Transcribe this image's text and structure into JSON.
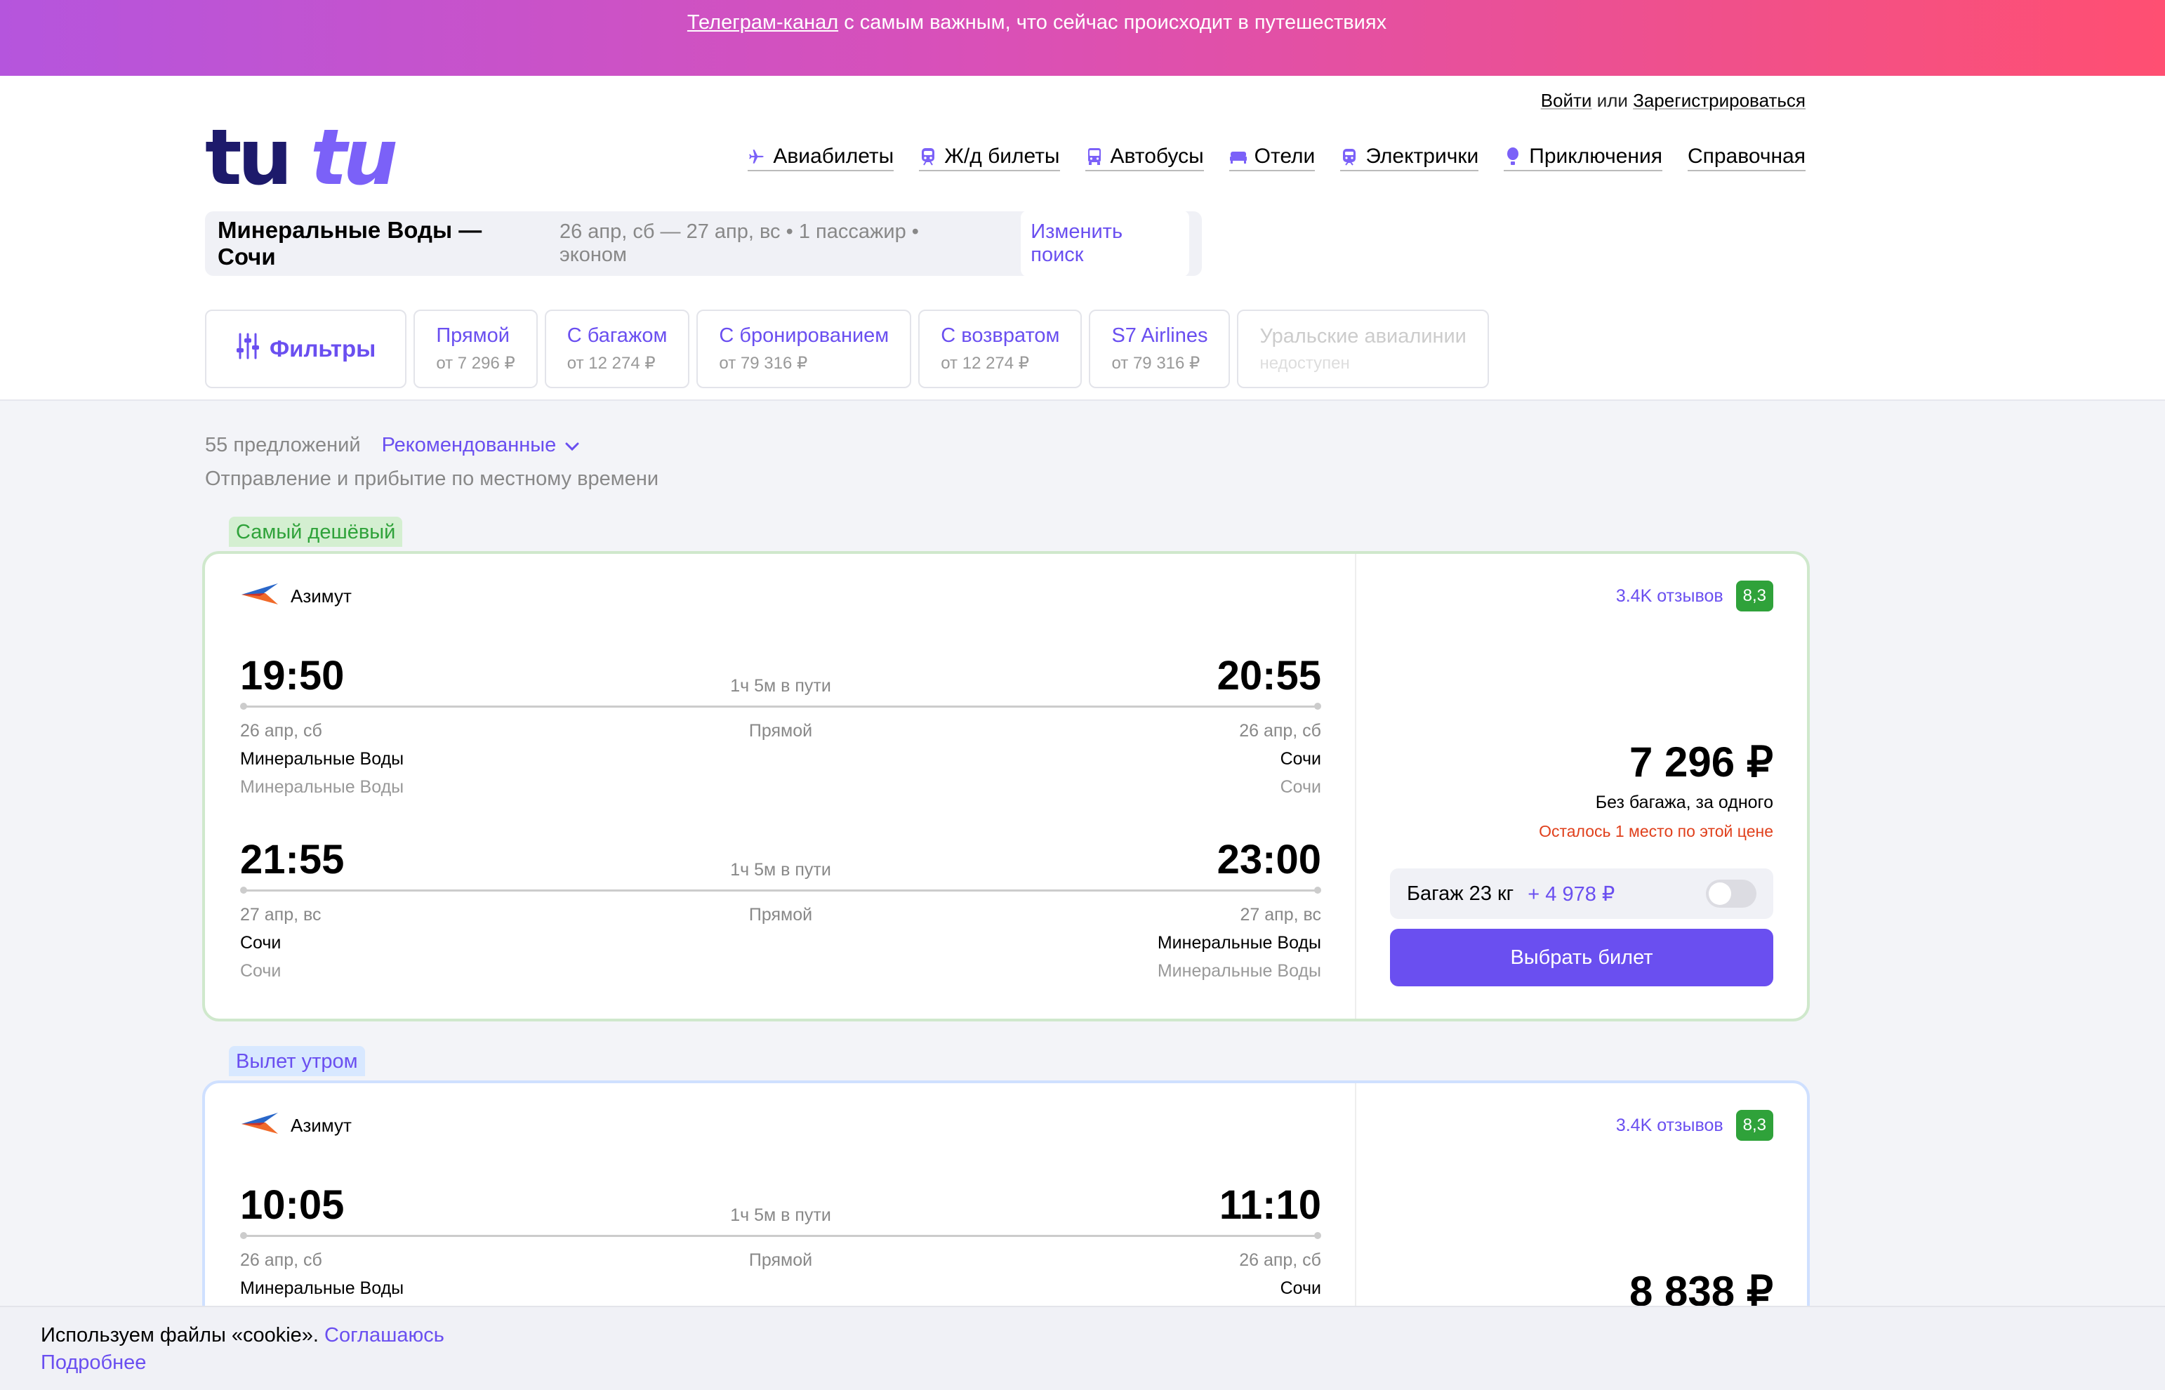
{
  "promo": {
    "link": "Телеграм-канал",
    "text": " с самым важным, что сейчас происходит в путешествиях"
  },
  "auth": {
    "login": "Войти",
    "or": " или ",
    "register": "Зарегистрироваться"
  },
  "logo": {
    "text_dark": "tu",
    "text_light": "tu"
  },
  "nav": [
    {
      "label": "Авиабилеты",
      "icon": "plane-icon"
    },
    {
      "label": "Ж/д билеты",
      "icon": "train-icon"
    },
    {
      "label": "Автобусы",
      "icon": "bus-icon"
    },
    {
      "label": "Отели",
      "icon": "bed-icon"
    },
    {
      "label": "Электрички",
      "icon": "suburban-train-icon"
    },
    {
      "label": "Приключения",
      "icon": "balloon-icon"
    },
    {
      "label": "Справочная",
      "icon": ""
    }
  ],
  "search": {
    "route": "Минеральные Воды — Сочи",
    "details": "26 апр, сб — 27 апр, вс • 1 пассажир • эконом",
    "change": "Изменить поиск"
  },
  "filters": {
    "main": "Фильтры",
    "chips": [
      {
        "title": "Прямой",
        "sub": "от 7 296 ₽"
      },
      {
        "title": "С багажом",
        "sub": "от 12 274 ₽"
      },
      {
        "title": "С бронированием",
        "sub": "от 79 316 ₽"
      },
      {
        "title": "С возвратом",
        "sub": "от 12 274 ₽"
      },
      {
        "title": "S7 Airlines",
        "sub": "от 79 316 ₽"
      },
      {
        "title": "Уральские авиалинии",
        "sub": "недоступен"
      }
    ]
  },
  "results": {
    "count": "55 предложений",
    "sort": "Рекомендованные",
    "note": "Отправление и прибытие по местному времени"
  },
  "offers": [
    {
      "badge": "Самый дешёвый",
      "airline": "Азимут",
      "reviews": "3.4K отзывов",
      "score": "8,3",
      "legs": [
        {
          "dep_time": "19:50",
          "arr_time": "20:55",
          "duration": "1ч 5м в пути",
          "stops": "Прямой",
          "dep_date": "26 апр, сб",
          "arr_date": "26 апр, сб",
          "dep_city": "Минеральные Воды",
          "arr_city": "Сочи",
          "dep_airport": "Минеральные Воды",
          "arr_airport": "Сочи"
        },
        {
          "dep_time": "21:55",
          "arr_time": "23:00",
          "duration": "1ч 5м в пути",
          "stops": "Прямой",
          "dep_date": "27 апр, вс",
          "arr_date": "27 апр, вс",
          "dep_city": "Сочи",
          "arr_city": "Минеральные Воды",
          "dep_airport": "Сочи",
          "arr_airport": "Минеральные Воды"
        }
      ],
      "price": "7 296 ₽",
      "price_note": "Без багажа, за одного",
      "warning": "Осталось 1 место по этой цене",
      "baggage": "Багаж 23 кг",
      "baggage_price": "+ 4 978 ₽",
      "select": "Выбрать билет"
    },
    {
      "badge": "Вылет утром",
      "airline": "Азимут",
      "reviews": "3.4K отзывов",
      "score": "8,3",
      "legs": [
        {
          "dep_time": "10:05",
          "arr_time": "11:10",
          "duration": "1ч 5м в пути",
          "stops": "Прямой",
          "dep_date": "26 апр, сб",
          "arr_date": "26 апр, сб",
          "dep_city": "Минеральные Воды",
          "arr_city": "Сочи"
        }
      ],
      "price": "8 838 ₽"
    }
  ],
  "cookie": {
    "text": "Используем файлы «cookie». ",
    "agree": "Соглашаюсь",
    "more": "Подробнее"
  },
  "colors": {
    "accent": "#6a4ff0",
    "green": "#2fa23a",
    "warning": "#e0401c"
  }
}
